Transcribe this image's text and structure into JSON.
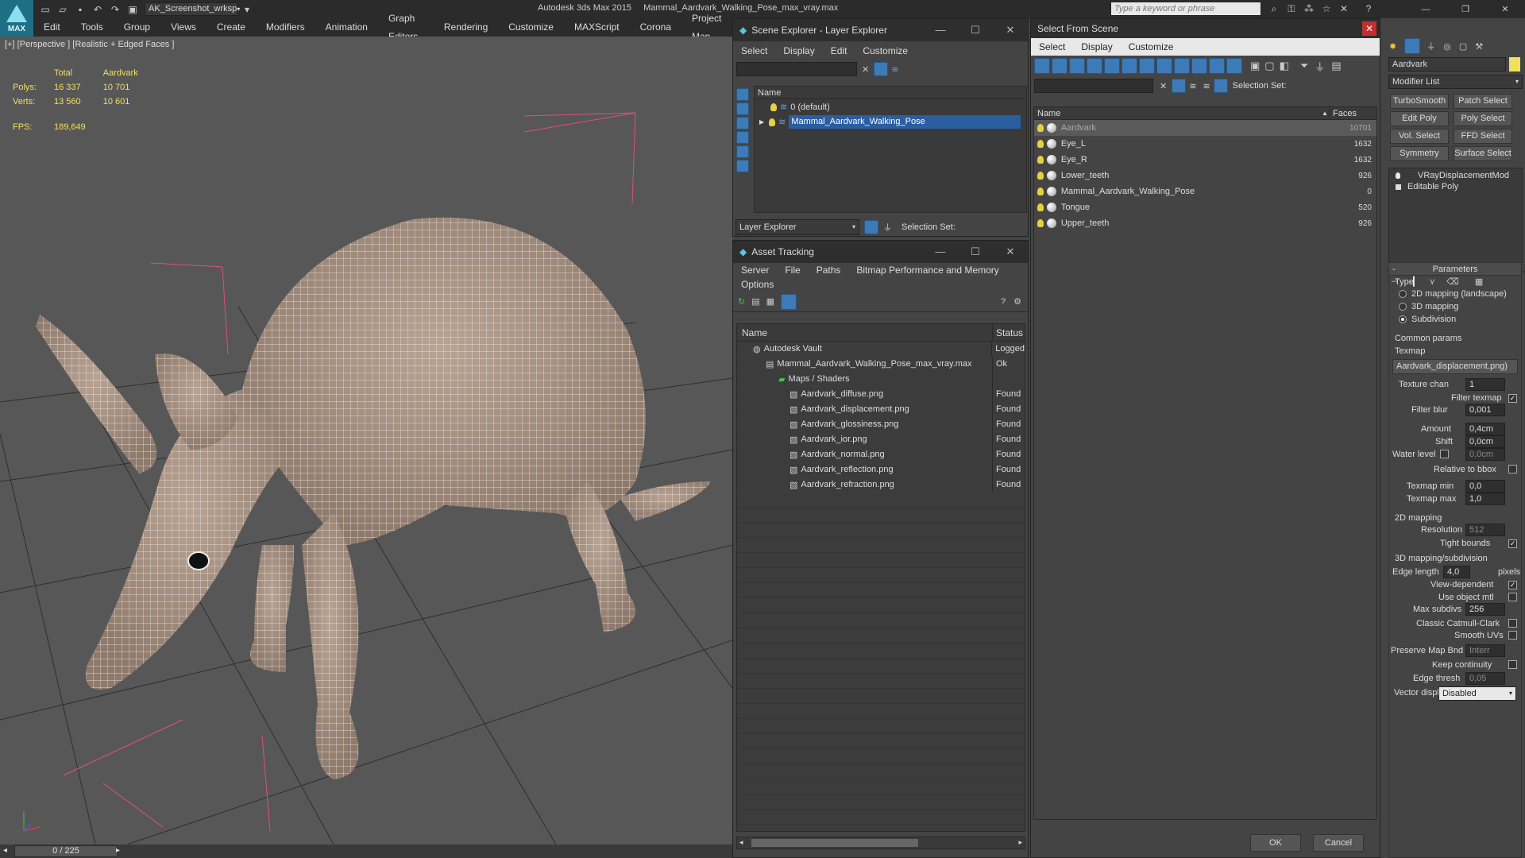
{
  "app": {
    "title": "Autodesk 3ds Max  2015",
    "file_title": "Mammal_Aardvark_Walking_Pose_max_vray.max",
    "workspace": "AK_Screenshot_wrksp",
    "search_placeholder": "Type a keyword or phrase",
    "logo_label": "MAX"
  },
  "menu": [
    "Edit",
    "Tools",
    "Group",
    "Views",
    "Create",
    "Modifiers",
    "Animation",
    "Graph Editors",
    "Rendering",
    "Customize",
    "MAXScript",
    "Corona",
    "Project Man"
  ],
  "viewport": {
    "label": "[+] [Perspective ] [Realistic + Edged Faces ]",
    "stats": {
      "col_total": "Total",
      "col_object": "Aardvark",
      "polys_label": "Polys:",
      "polys_total": "16 337",
      "polys_object": "10 701",
      "verts_label": "Verts:",
      "verts_total": "13 560",
      "verts_object": "10 601",
      "fps_label": "FPS:",
      "fps_value": "189,649"
    },
    "timeline": "0 / 225"
  },
  "scene_explorer": {
    "title": "Scene Explorer - Layer Explorer",
    "menu": [
      "Select",
      "Display",
      "Edit",
      "Customize"
    ],
    "col_name": "Name",
    "layers": [
      "0 (default)",
      "Mammal_Aardvark_Walking_Pose"
    ],
    "footer_dropdown": "Layer Explorer",
    "selection_set": "Selection Set:"
  },
  "asset_tracking": {
    "title": "Asset Tracking",
    "menu": [
      "Server",
      "File",
      "Paths",
      "Bitmap Performance and Memory"
    ],
    "menu2": "Options",
    "col_name": "Name",
    "col_status": "Status",
    "rows": [
      {
        "name": "Autodesk Vault",
        "status": "Logged"
      },
      {
        "name": "Mammal_Aardvark_Walking_Pose_max_vray.max",
        "status": "Ok"
      },
      {
        "name": "Maps / Shaders",
        "status": ""
      },
      {
        "name": "Aardvark_diffuse.png",
        "status": "Found"
      },
      {
        "name": "Aardvark_displacement.png",
        "status": "Found"
      },
      {
        "name": "Aardvark_glossiness.png",
        "status": "Found"
      },
      {
        "name": "Aardvark_ior.png",
        "status": "Found"
      },
      {
        "name": "Aardvark_normal.png",
        "status": "Found"
      },
      {
        "name": "Aardvark_reflection.png",
        "status": "Found"
      },
      {
        "name": "Aardvark_refraction.png",
        "status": "Found"
      }
    ]
  },
  "select_from_scene": {
    "title": "Select From Scene",
    "menu": [
      "Select",
      "Display",
      "Customize"
    ],
    "selection_set": "Selection Set:",
    "col_name": "Name",
    "col_faces": "Faces",
    "rows": [
      {
        "name": "Aardvark",
        "faces": "10701"
      },
      {
        "name": "Eye_L",
        "faces": "1632"
      },
      {
        "name": "Eye_R",
        "faces": "1632"
      },
      {
        "name": "Lower_teeth",
        "faces": "926"
      },
      {
        "name": "Mammal_Aardvark_Walking_Pose",
        "faces": "0"
      },
      {
        "name": "Tongue",
        "faces": "520"
      },
      {
        "name": "Upper_teeth",
        "faces": "926"
      }
    ],
    "ok": "OK",
    "cancel": "Cancel"
  },
  "command_panel": {
    "object_name": "Aardvark",
    "modifier_list": "Modifier List",
    "mod_buttons": [
      "TurboSmooth",
      "Patch Select",
      "Edit Poly",
      "Poly Select",
      "Vol. Select",
      "FFD Select",
      "Symmetry",
      "Surface Select"
    ],
    "stack": [
      "VRayDisplacementMod",
      "Editable Poly"
    ],
    "rollout": "Parameters",
    "type_label": "Type",
    "types": [
      "2D mapping (landscape)",
      "3D mapping",
      "Subdivision"
    ],
    "common_params": "Common params",
    "texmap_label": "Texmap",
    "texmap_value": "Aardvark_displacement.png)",
    "texture_chan_label": "Texture chan",
    "texture_chan": "1",
    "filter_texmap": "Filter texmap",
    "filter_blur_label": "Filter blur",
    "filter_blur": "0,001",
    "amount_label": "Amount",
    "amount": "0,4cm",
    "shift_label": "Shift",
    "shift": "0,0cm",
    "water_level_label": "Water level",
    "water_level": "0,0cm",
    "relative_bbox": "Relative to bbox",
    "texmap_min_label": "Texmap min",
    "texmap_min": "0,0",
    "texmap_max_label": "Texmap max",
    "texmap_max": "1,0",
    "mapping2d": "2D mapping",
    "resolution_label": "Resolution",
    "resolution": "512",
    "tight_bounds": "Tight bounds",
    "mapping3d": "3D mapping/subdivision",
    "edge_length_label": "Edge length",
    "edge_length": "4,0",
    "pixels": "pixels",
    "view_dependent": "View-dependent",
    "use_object_mtl": "Use object mtl",
    "max_subdivs_label": "Max subdivs",
    "max_subdivs": "256",
    "catmull": "Classic Catmull-Clark",
    "smooth_uvs": "Smooth UVs",
    "preserve_map_label": "Preserve Map Bnd",
    "preserve_map": "Interr",
    "keep_continuity": "Keep continuity",
    "edge_thresh_label": "Edge thresh",
    "edge_thresh": "0,05",
    "vector_disp_label": "Vector displ",
    "vector_disp": "Disabled"
  }
}
